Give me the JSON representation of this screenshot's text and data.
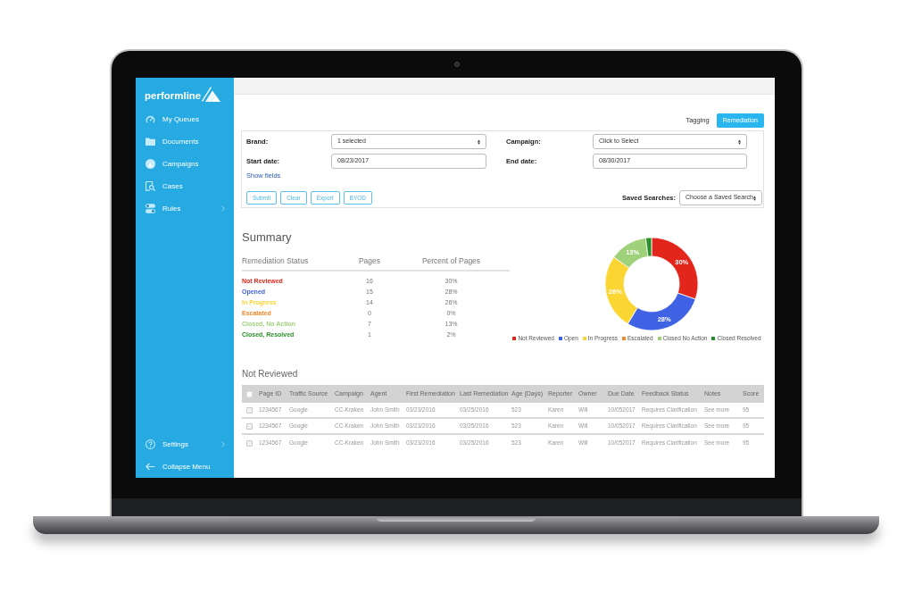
{
  "sidebar": {
    "logo": "performline",
    "items": [
      {
        "label": "My Queues",
        "expandable": false
      },
      {
        "label": "Documents",
        "expandable": false
      },
      {
        "label": "Campaigns",
        "expandable": false
      },
      {
        "label": "Cases",
        "expandable": false
      },
      {
        "label": "Rules",
        "expandable": true
      }
    ],
    "footer_items": [
      {
        "label": "Settings",
        "expandable": true
      },
      {
        "label": "Collapse Menu",
        "expandable": false
      }
    ]
  },
  "mode_tabs": [
    {
      "label": "Tagging",
      "selected": false
    },
    {
      "label": "Remediation",
      "selected": true
    }
  ],
  "filters": {
    "fields": [
      {
        "label": "Brand:",
        "kind": "select",
        "value": "1 selected"
      },
      {
        "label": "Campaign:",
        "kind": "select",
        "value": "Click to Select"
      },
      {
        "label": "Start date:",
        "kind": "date",
        "value": "08/23/2017"
      },
      {
        "label": "End date:",
        "kind": "date",
        "value": "08/30/2017"
      }
    ],
    "show_fields_link": "Show fields",
    "buttons": [
      "Submit",
      "Clear",
      "Export",
      "BYOD"
    ],
    "saved_searches": {
      "label": "Saved Searches:",
      "value": "Choose a Saved Search"
    }
  },
  "summary": {
    "title": "Summary",
    "columns": [
      "Remediation Status",
      "Pages",
      "Percent of Pages"
    ],
    "rows": [
      {
        "status": "Not Reviewed",
        "color": "#e3261b",
        "pages": "16",
        "percent": "30%"
      },
      {
        "status": "Opened",
        "color": "#3f62e4",
        "pages": "15",
        "percent": "28%"
      },
      {
        "status": "In Progress",
        "color": "#fbd531",
        "pages": "14",
        "percent": "26%"
      },
      {
        "status": "Escalated",
        "color": "#f7862b",
        "pages": "0",
        "percent": "0%"
      },
      {
        "status": "Closed, No Action",
        "color": "#9fd07a",
        "pages": "7",
        "percent": "13%"
      },
      {
        "status": "Closed, Resolved",
        "color": "#2a8f2a",
        "pages": "1",
        "percent": "2%"
      }
    ],
    "chart_data": {
      "type": "donut",
      "categories": [
        "Not Reviewed",
        "Open",
        "In Progress",
        "Escalated",
        "Closed No Action",
        "Closed Resolved"
      ],
      "series": [
        {
          "values": [
            30,
            28,
            26,
            0,
            13,
            2
          ]
        }
      ],
      "value_labels": [
        "30%",
        "28%",
        "26%",
        null,
        "13%",
        null
      ],
      "legend": "bottom"
    }
  },
  "not_reviewed": {
    "title": "Not Reviewed",
    "select_all_checked": false,
    "columns": [
      "Page ID",
      "Traffic Source",
      "Campaign",
      "Agent",
      "First Remediation",
      "Last Remediation",
      "Age (Days)",
      "Reporter",
      "Owner",
      "Due Date",
      "Feedback Status",
      "Notes",
      "Score"
    ],
    "rows": [
      {
        "checked": false,
        "cells": [
          "1234567",
          "Google",
          "CC-Kraken",
          "John Smith",
          "03/23/2016",
          "03/25/2016",
          "523",
          "Karen",
          "Will",
          "10/052017",
          "Requires Clarification",
          "See more",
          "95"
        ]
      },
      {
        "checked": false,
        "cells": [
          "1234567",
          "Google",
          "CC-Kraken",
          "John Smith",
          "03/23/2016",
          "03/25/2016",
          "523",
          "Karen",
          "Will",
          "10/052017",
          "Requires Clarification",
          "See more",
          "95"
        ]
      },
      {
        "checked": false,
        "cells": [
          "1234567",
          "Google",
          "CC-Kraken",
          "John Smith",
          "03/23/2016",
          "03/25/2016",
          "523",
          "Karen",
          "Will",
          "10/052017",
          "Requires Clarification",
          "See more",
          "95"
        ]
      }
    ]
  }
}
